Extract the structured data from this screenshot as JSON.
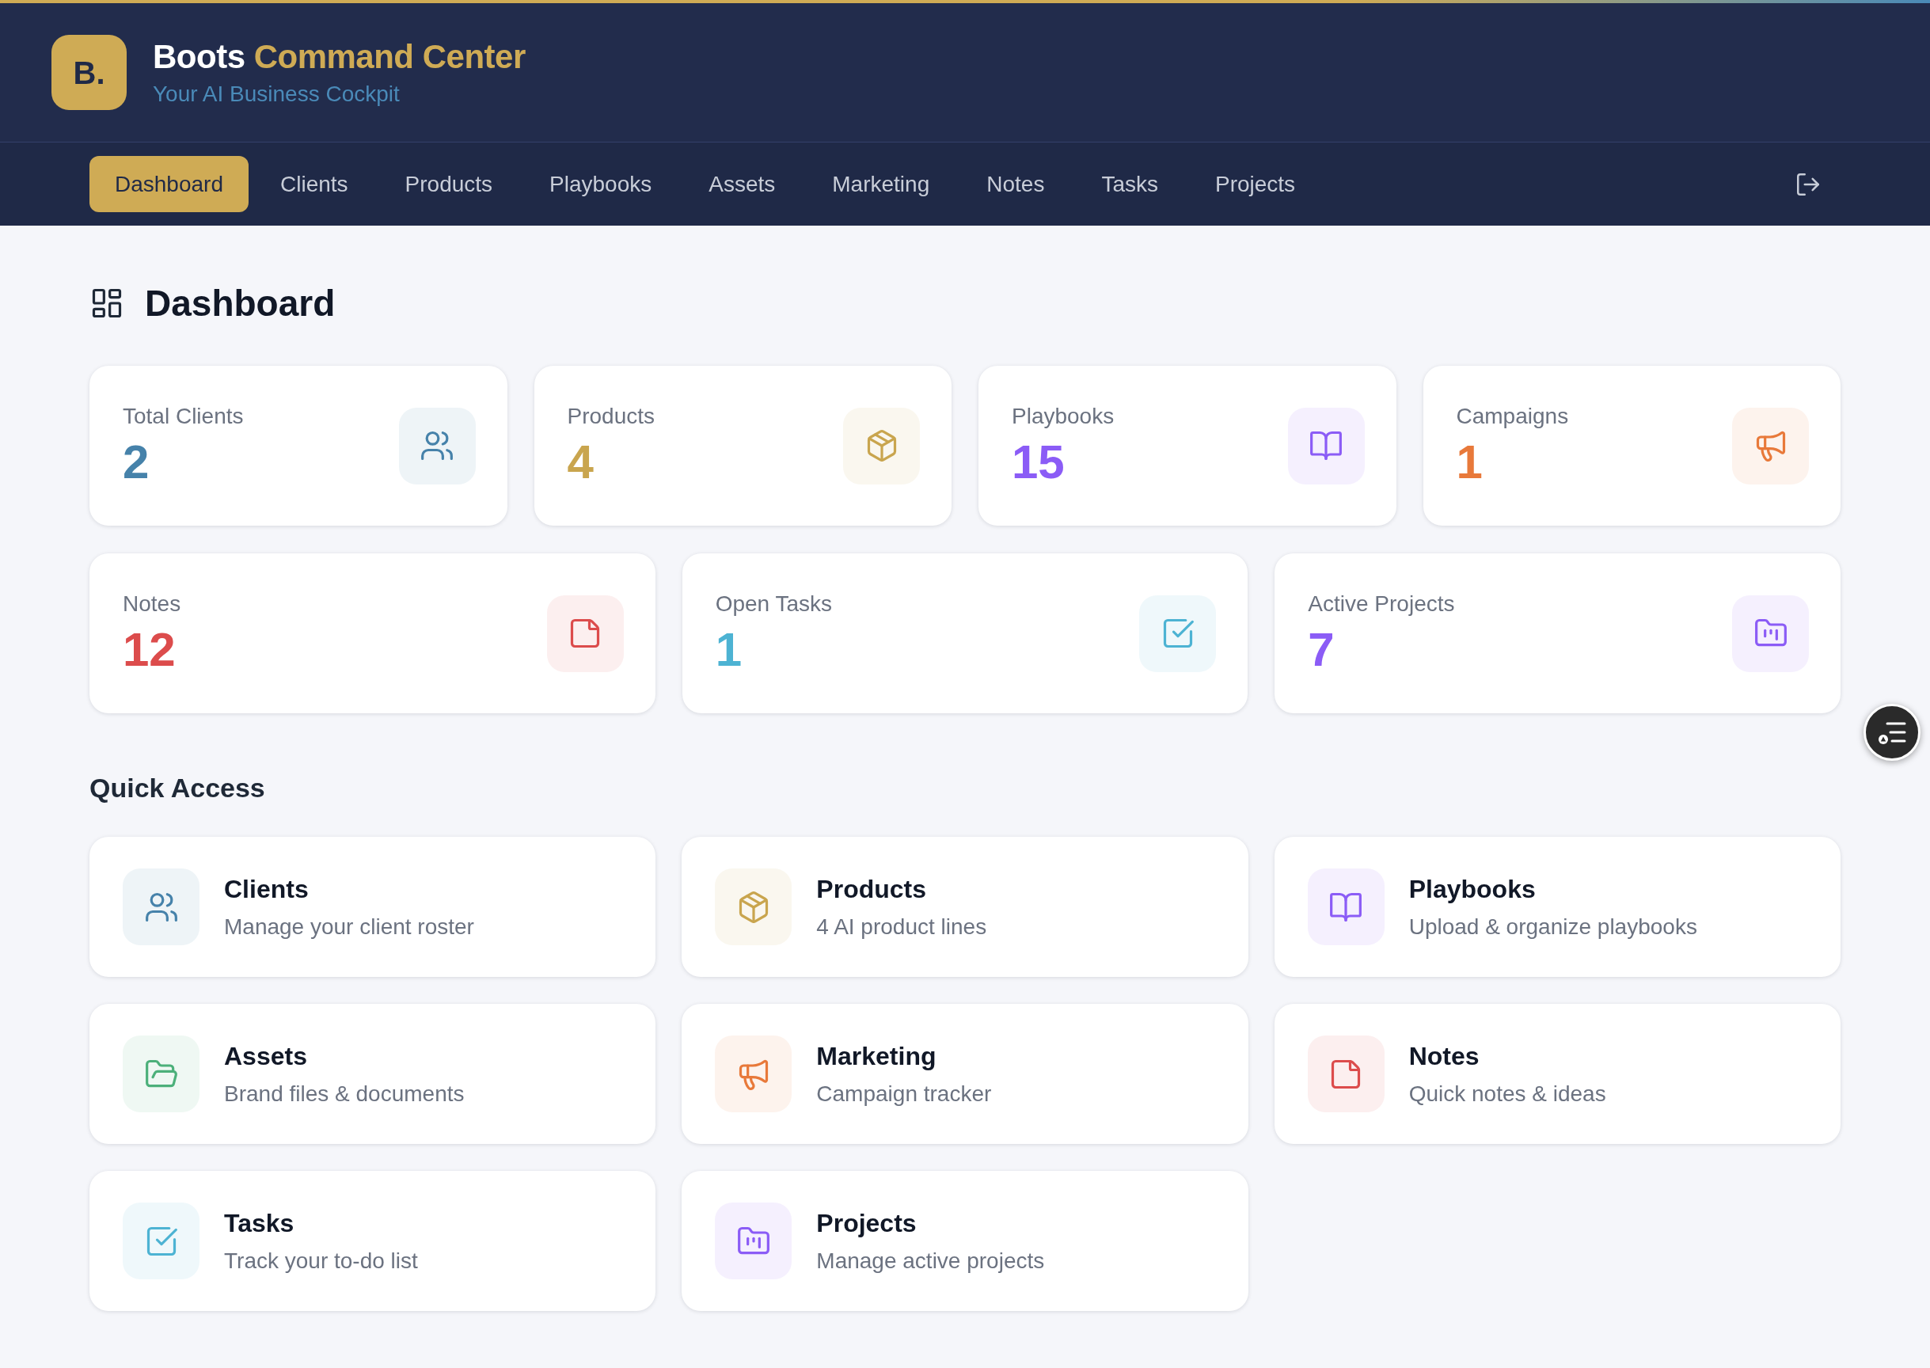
{
  "header": {
    "logo": "B.",
    "title_lead": "Boots",
    "title_accent": "Command Center",
    "subtitle": "Your AI Business Cockpit"
  },
  "nav": {
    "items": [
      {
        "label": "Dashboard",
        "selected": true
      },
      {
        "label": "Clients",
        "selected": false
      },
      {
        "label": "Products",
        "selected": false
      },
      {
        "label": "Playbooks",
        "selected": false
      },
      {
        "label": "Assets",
        "selected": false
      },
      {
        "label": "Marketing",
        "selected": false
      },
      {
        "label": "Notes",
        "selected": false
      },
      {
        "label": "Tasks",
        "selected": false
      },
      {
        "label": "Projects",
        "selected": false
      }
    ]
  },
  "page_title": "Dashboard",
  "stat_rows": [
    {
      "cards": [
        {
          "kind": "clients",
          "label": "Total Clients",
          "value": "2",
          "color": "#4682aa"
        },
        {
          "kind": "products",
          "label": "Products",
          "value": "4",
          "color": "#c9a54e"
        },
        {
          "kind": "playbooks",
          "label": "Playbooks",
          "value": "15",
          "color": "#8b5cf6"
        },
        {
          "kind": "campaigns",
          "label": "Campaigns",
          "value": "1",
          "color": "#e8793a"
        }
      ]
    },
    {
      "cards": [
        {
          "kind": "notes",
          "label": "Notes",
          "value": "12",
          "color": "#dc4c4c"
        },
        {
          "kind": "tasks",
          "label": "Open Tasks",
          "value": "1",
          "color": "#4db3d3"
        },
        {
          "kind": "projects",
          "label": "Active Projects",
          "value": "7",
          "color": "#8b5cf6"
        }
      ]
    }
  ],
  "quick_access": {
    "title": "Quick Access",
    "items": [
      {
        "kind": "clients",
        "title": "Clients",
        "description": "Manage your client roster",
        "color": "#4682aa"
      },
      {
        "kind": "products",
        "title": "Products",
        "description": "4 AI product lines",
        "color": "#c9a54e"
      },
      {
        "kind": "playbooks",
        "title": "Playbooks",
        "description": "Upload & organize playbooks",
        "color": "#8b5cf6"
      },
      {
        "kind": "assets",
        "title": "Assets",
        "description": "Brand files & documents",
        "color": "#4cb07a"
      },
      {
        "kind": "marketing",
        "title": "Marketing",
        "description": "Campaign tracker",
        "color": "#e8793a"
      },
      {
        "kind": "notes",
        "title": "Notes",
        "description": "Quick notes & ideas",
        "color": "#dc4c4c"
      },
      {
        "kind": "tasks",
        "title": "Tasks",
        "description": "Track your to-do list",
        "color": "#4db3d3"
      },
      {
        "kind": "projects",
        "title": "Projects",
        "description": "Manage active projects",
        "color": "#8b5cf6"
      }
    ]
  }
}
